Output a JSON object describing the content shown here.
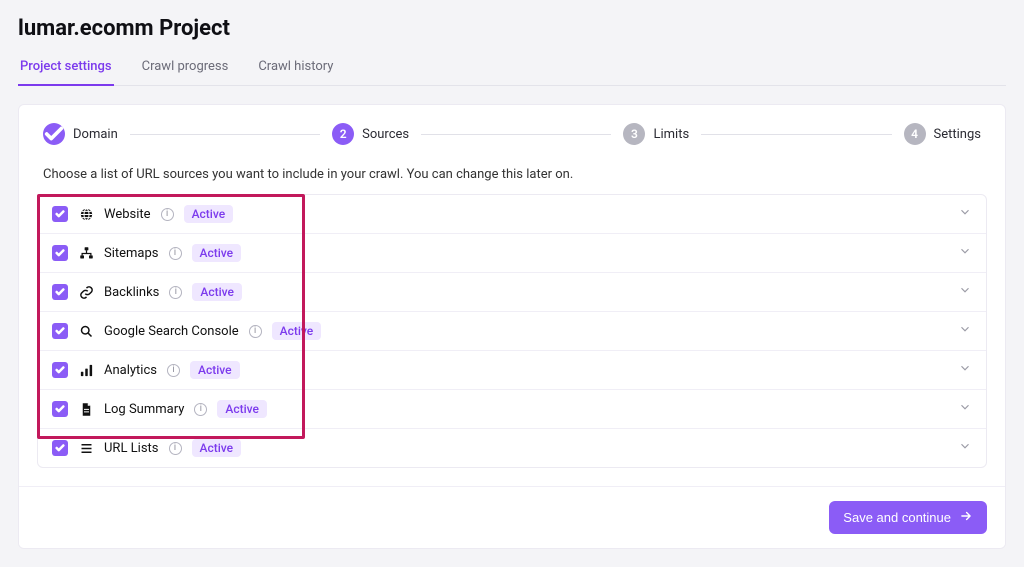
{
  "header": {
    "title": "lumar.ecomm Project"
  },
  "tabs": {
    "items": [
      {
        "label": "Project settings",
        "active": true
      },
      {
        "label": "Crawl progress",
        "active": false
      },
      {
        "label": "Crawl history",
        "active": false
      }
    ]
  },
  "stepper": {
    "steps": [
      {
        "label": "Domain",
        "state": "done"
      },
      {
        "label": "Sources",
        "state": "current",
        "number": "2"
      },
      {
        "label": "Limits",
        "state": "pending",
        "number": "3"
      },
      {
        "label": "Settings",
        "state": "pending",
        "number": "4"
      }
    ]
  },
  "intro": "Choose a list of URL sources you want to include in your crawl. You can change this later on.",
  "sources": [
    {
      "icon": "globe-icon",
      "label": "Website",
      "badge": "Active",
      "highlight": true
    },
    {
      "icon": "sitemap-icon",
      "label": "Sitemaps",
      "badge": "Active",
      "highlight": true
    },
    {
      "icon": "link-icon",
      "label": "Backlinks",
      "badge": "Active",
      "highlight": true
    },
    {
      "icon": "search-icon",
      "label": "Google Search Console",
      "badge": "Active",
      "highlight": true
    },
    {
      "icon": "analytics-icon",
      "label": "Analytics",
      "badge": "Active",
      "highlight": true
    },
    {
      "icon": "file-icon",
      "label": "Log Summary",
      "badge": "Active",
      "highlight": true
    },
    {
      "icon": "list-icon",
      "label": "URL Lists",
      "badge": "Active",
      "highlight": false
    }
  ],
  "footer": {
    "primary": "Save and continue"
  },
  "colors": {
    "accent": "#8b5cf6",
    "badge_bg": "#efe7ff",
    "highlight": "#c2185b"
  }
}
